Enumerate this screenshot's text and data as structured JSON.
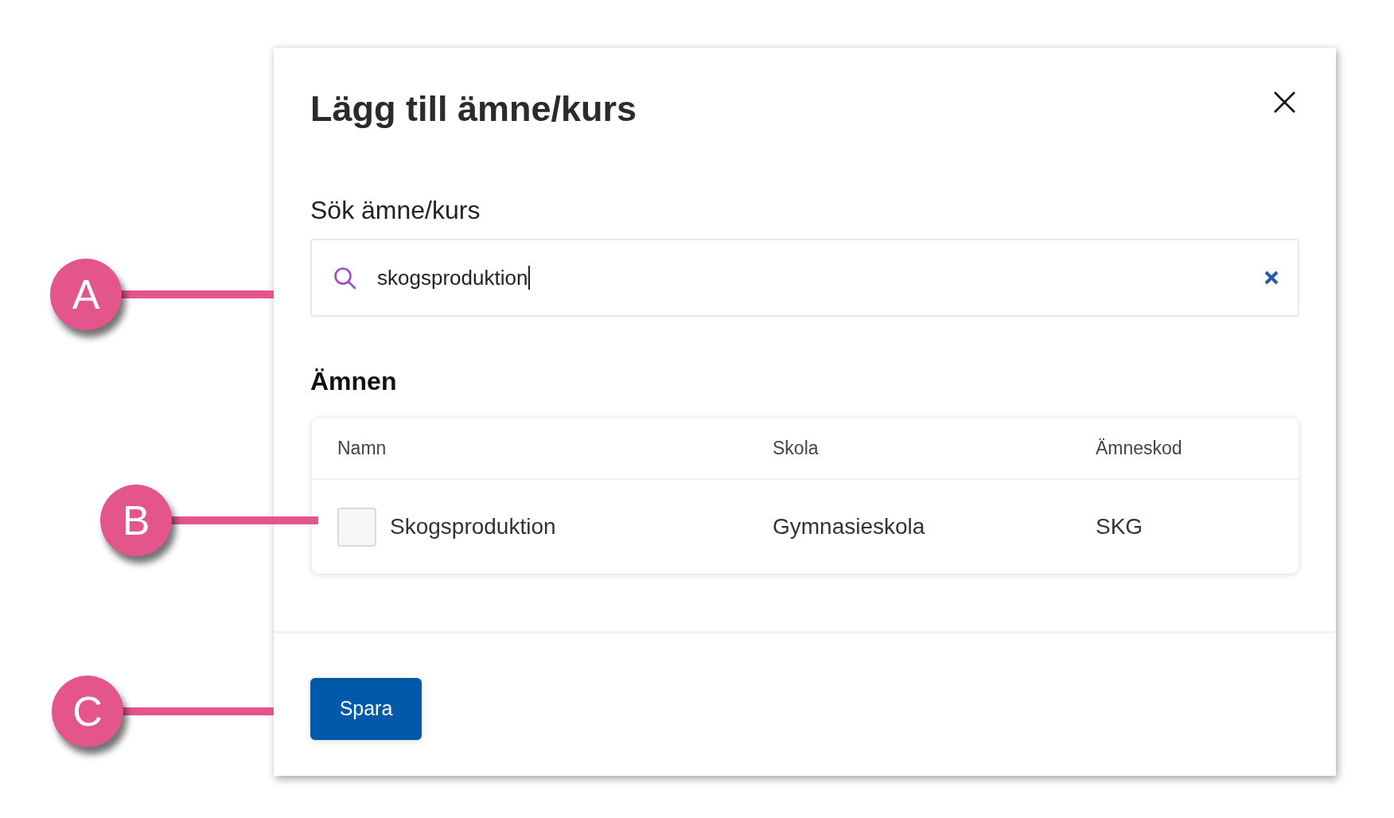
{
  "dialog": {
    "title": "Lägg till ämne/kurs",
    "search": {
      "label": "Sök ämne/kurs",
      "value": "skogsproduktion",
      "focused": true
    },
    "results_heading": "Ämnen",
    "table": {
      "columns": [
        "Namn",
        "Skola",
        "Ämneskod"
      ],
      "rows": [
        {
          "cells": [
            "Skogsproduktion",
            "Gymnasieskola",
            "SKG"
          ],
          "checked": false
        }
      ]
    },
    "save_button": "Spara"
  },
  "callouts": [
    {
      "label": "A"
    },
    {
      "label": "B"
    },
    {
      "label": "C"
    }
  ]
}
